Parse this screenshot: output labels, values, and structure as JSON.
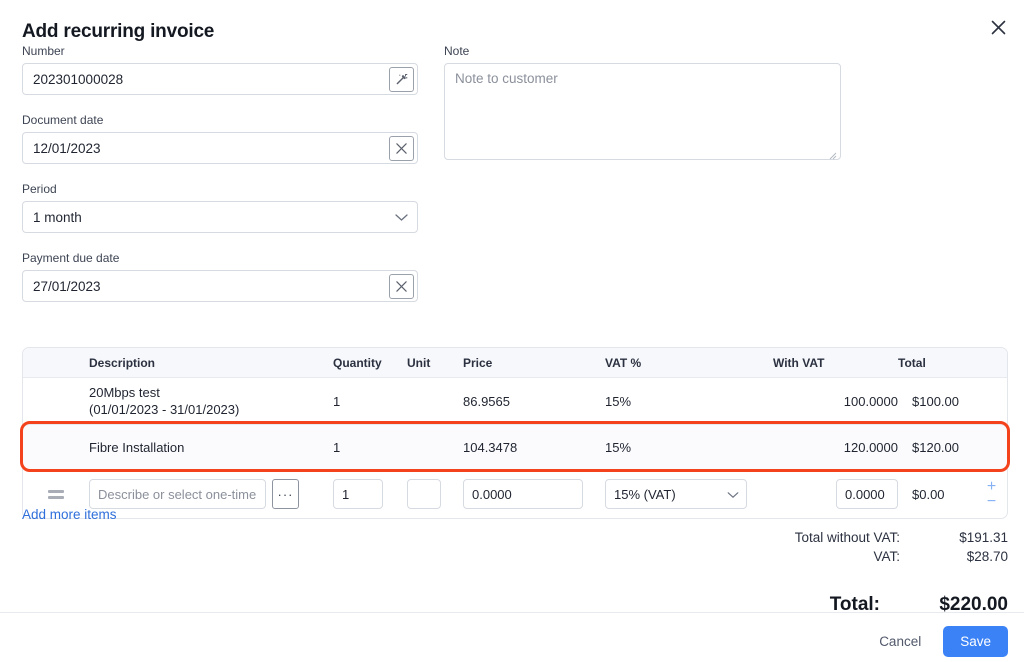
{
  "dialog": {
    "title": "Add recurring invoice",
    "close_icon": "close-icon"
  },
  "form": {
    "number": {
      "label": "Number",
      "value": "202301000028",
      "placeholder": "",
      "action_icon": "magic-wand-icon"
    },
    "document_date": {
      "label": "Document date",
      "value": "12/01/2023",
      "placeholder": "",
      "action_icon": "clear-icon"
    },
    "period": {
      "label": "Period",
      "value": "1 month",
      "chevron_icon": "chevron-down-icon"
    },
    "payment_due_date": {
      "label": "Payment due date",
      "value": "27/01/2023",
      "placeholder": "",
      "action_icon": "clear-icon"
    },
    "note": {
      "label": "Note",
      "value": "",
      "placeholder": "Note to customer",
      "resize_icon": "resize-grip-icon"
    }
  },
  "items_table": {
    "columns": [
      "Description",
      "Quantity",
      "Unit",
      "Price",
      "VAT %",
      "With VAT",
      "Total"
    ],
    "rows": [
      {
        "description_line1": "20Mbps test",
        "description_line2": "(01/01/2023 - 31/01/2023)",
        "quantity": "1",
        "unit": "",
        "price": "86.9565",
        "vat": "15%",
        "with_vat": "100.0000",
        "total": "$100.00",
        "highlighted": false
      },
      {
        "description_line1": "Fibre Installation",
        "description_line2": "",
        "quantity": "1",
        "unit": "",
        "price": "104.3478",
        "vat": "15%",
        "with_vat": "120.0000",
        "total": "$120.00",
        "highlighted": true
      }
    ],
    "edit_row": {
      "drag_handle_icon": "drag-handle-icon",
      "description_placeholder": "Describe or select one-time item",
      "description_value": "",
      "browse_label": "···",
      "quantity": "1",
      "unit": "",
      "price": "0.0000",
      "vat": "15% (VAT)",
      "vat_chevron_icon": "chevron-down-icon",
      "with_vat": "0.0000",
      "total": "$0.00",
      "add_label": "+",
      "remove_label": "−"
    }
  },
  "add_more_items": "Add more items",
  "totals": {
    "without_vat_label": "Total without VAT:",
    "without_vat_value": "$191.31",
    "vat_label": "VAT:",
    "vat_value": "$28.70",
    "grand_label": "Total:",
    "grand_value": "$220.00"
  },
  "footer": {
    "cancel_label": "Cancel",
    "save_label": "Save"
  },
  "colors": {
    "accent": "#3b82f6",
    "highlight": "#f4421d",
    "link": "#2f6fdb"
  }
}
